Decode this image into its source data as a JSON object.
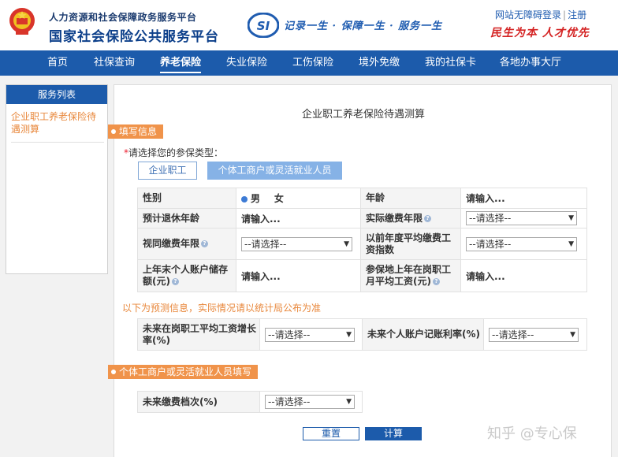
{
  "header": {
    "sub_title": "人力资源和社会保障政务服务平台",
    "main_title": "国家社会保险公共服务平台",
    "si_mark": "SI",
    "slogan": "记录一生 · 保障一生 · 服务一生",
    "accessibility_link": "网站无障碍",
    "login_link": "登录",
    "register_link": "注册",
    "link_separator": "|",
    "red_slogan": "民生为本 人才优先"
  },
  "nav": {
    "items": [
      {
        "label": "首页"
      },
      {
        "label": "社保查询"
      },
      {
        "label": "养老保险",
        "active": true
      },
      {
        "label": "失业保险"
      },
      {
        "label": "工伤保险"
      },
      {
        "label": "境外免缴"
      },
      {
        "label": "我的社保卡"
      },
      {
        "label": "各地办事大厅"
      }
    ]
  },
  "sidebar": {
    "title": "服务列表",
    "items": [
      {
        "label": "企业职工养老保险待遇测算"
      }
    ]
  },
  "form": {
    "title": "企业职工养老保险待遇测算",
    "section_fill": "填写信息",
    "required_star": "*",
    "type_prompt": "请选择您的参保类型：",
    "type_options": [
      "企业职工",
      "个体工商户或灵活就业人员"
    ],
    "selected_type": "个体工商户或灵活就业人员",
    "fields": {
      "gender_label": "性别",
      "gender_male": "男",
      "gender_female": "女",
      "age_label": "年龄",
      "age_placeholder": "请输入...",
      "retire_age_label": "预计退休年龄",
      "retire_age_placeholder": "请输入...",
      "actual_years_label": "实际缴费年限",
      "actual_years_value": "--请选择--",
      "deemed_years_label": "视同缴费年限",
      "deemed_years_value": "--请选择--",
      "avg_index_label": "以前年度平均缴费工资指数",
      "avg_index_value": "--请选择--",
      "balance_label": "上年末个人账户储存额(元)",
      "balance_placeholder": "请输入...",
      "local_wage_label": "参保地上年在岗职工月平均工资(元)",
      "local_wage_placeholder": "请输入..."
    },
    "forecast_note": "以下为预测信息，实际情况请以统计局公布为准",
    "forecast": {
      "wage_growth_label": "未来在岗职工平均工资增长率(%)",
      "wage_growth_value": "--请选择--",
      "account_rate_label": "未来个人账户记账利率(%)",
      "account_rate_value": "--请选择--"
    },
    "section_flexible": "个体工商户或灵活就业人员填写",
    "flexible": {
      "contribution_level_label": "未来缴费档次(%)",
      "contribution_level_value": "--请选择--"
    },
    "reset_label": "重置",
    "calc_label": "计算",
    "help_mark": "?",
    "select_arrow": "▼"
  },
  "watermark": "知乎 @专心保",
  "colors": {
    "brand_blue": "#1c5bab",
    "accent_orange": "#f0934a",
    "link_orange": "#e8873b",
    "slogan_red": "#d42323"
  }
}
